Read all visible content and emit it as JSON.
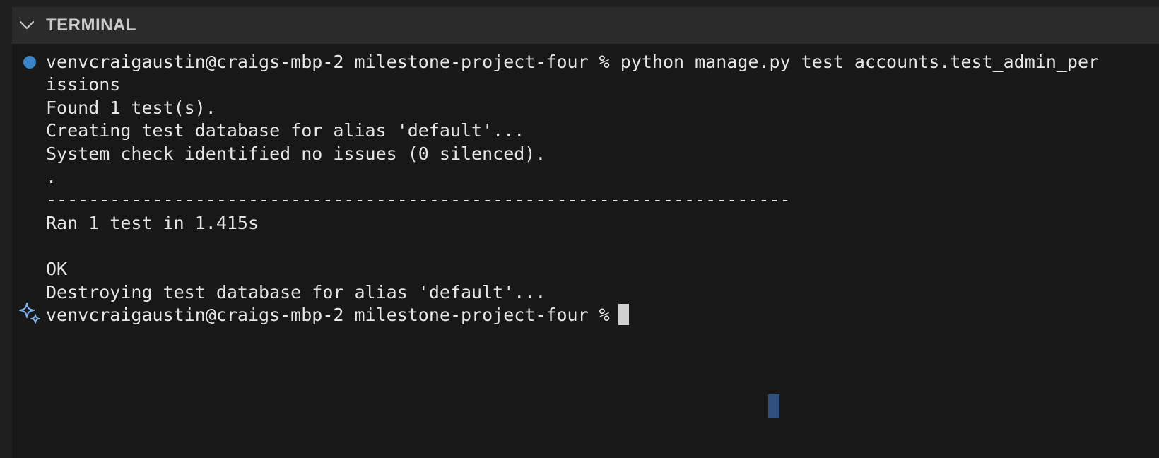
{
  "panel": {
    "title": "TERMINAL"
  },
  "terminal": {
    "lines": [
      "venvcraigaustin@craigs-mbp-2 milestone-project-four % python manage.py test accounts.test_admin_permissions",
      "issions",
      "Found 1 test(s).",
      "Creating test database for alias 'default'...",
      "System check identified no issues (0 silenced).",
      ".",
      "----------------------------------------------------------------------",
      "Ran 1 test in 1.415s",
      "",
      "OK",
      "Destroying test database for alias 'default'...",
      "venvcraigaustin@craigs-mbp-2 milestone-project-four %"
    ],
    "first_line_visible": "venvcraigaustin@craigs-mbp-2 milestone-project-four % python manage.py test accounts.test_admin_per"
  },
  "icons": {
    "status_dot": "circle-status-icon",
    "sparkle": "sparkle-icon",
    "collapse": "chevron-down-icon"
  },
  "colors": {
    "background": "#181818",
    "header": "#2b2b2b",
    "text": "#e6e6e6",
    "accent": "#3b83c8",
    "sparkle": "#7fb4f0"
  }
}
